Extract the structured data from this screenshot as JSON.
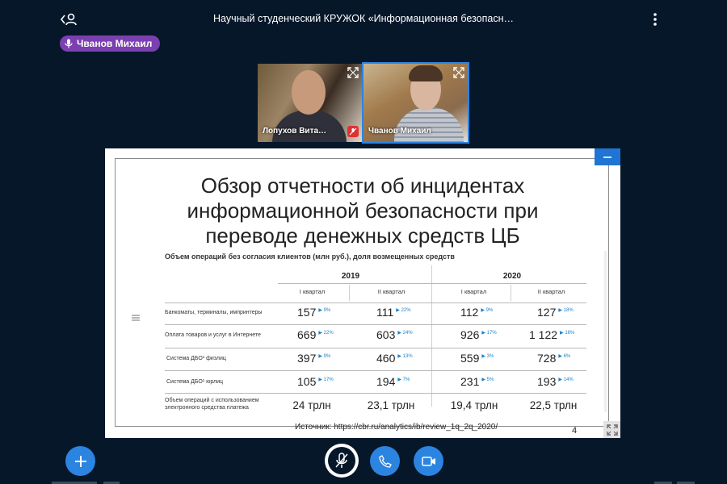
{
  "header": {
    "meeting_title": "Научный студенческий КРУЖОК «Информационная безопасн…",
    "current_talker": "Чванов Михаил"
  },
  "videos": [
    {
      "name": "Лопухов Вита…"
    },
    {
      "name": "Чванов Михаил"
    }
  ],
  "slide": {
    "title_lines": [
      "Обзор отчетности об инцидентах",
      "информационной безопасности при",
      "переводе денежных средств ЦБ"
    ],
    "table_caption": "Объем операций без согласия клиентов (млн руб.), доля возмещенных средств",
    "years": [
      "2019",
      "2020"
    ],
    "quarters": [
      "I квартал",
      "II квартал",
      "I квартал",
      "II квартал"
    ],
    "rows": [
      {
        "label": "Банкоматы, терминалы, импринтеры",
        "cells": [
          {
            "v": "157",
            "p": "9%"
          },
          {
            "v": "111",
            "p": "22%"
          },
          {
            "v": "112",
            "p": "9%"
          },
          {
            "v": "127",
            "p": "18%"
          }
        ]
      },
      {
        "label": "Оплата товаров и услуг в Интернете",
        "cells": [
          {
            "v": "669",
            "p": "22%"
          },
          {
            "v": "603",
            "p": "24%"
          },
          {
            "v": "926",
            "p": "17%"
          },
          {
            "v": "1 122",
            "p": "16%"
          }
        ]
      },
      {
        "label": "Система ДБО¹ физлиц",
        "cells": [
          {
            "v": "397",
            "p": "9%"
          },
          {
            "v": "460",
            "p": "13%"
          },
          {
            "v": "559",
            "p": "3%"
          },
          {
            "v": "728",
            "p": "6%"
          }
        ]
      },
      {
        "label": "Система ДБО¹ юрлиц",
        "cells": [
          {
            "v": "105",
            "p": "17%"
          },
          {
            "v": "194",
            "p": "7%"
          },
          {
            "v": "231",
            "p": "5%"
          },
          {
            "v": "193",
            "p": "14%"
          }
        ]
      }
    ],
    "total_row": {
      "label_line1": "Объем операций с использованием",
      "label_line2": "электронного средства платежа",
      "values": [
        "24 трлн",
        "23,1 трлн",
        "19,4 трлн",
        "22,5 трлн"
      ]
    },
    "source": "Источник: https://cbr.ru/analytics/ib/review_1q_2q_2020/",
    "page_number": "4"
  },
  "icons": {
    "users": "users-icon",
    "more": "more-vertical-icon",
    "mic_small": "mic-icon",
    "expand": "expand-icon",
    "muted_badge": "muted-mic-icon",
    "minimize": "minimize-icon",
    "fullscreen": "fullscreen-icon",
    "plus": "plus-icon",
    "mic_off": "mic-off-icon",
    "phone": "phone-icon",
    "camera": "camera-icon"
  },
  "colors": {
    "background": "#06172a",
    "accent": "#2b84e0",
    "talker_pill": "#7b3fb0",
    "percent_text": "#1a82c9"
  }
}
